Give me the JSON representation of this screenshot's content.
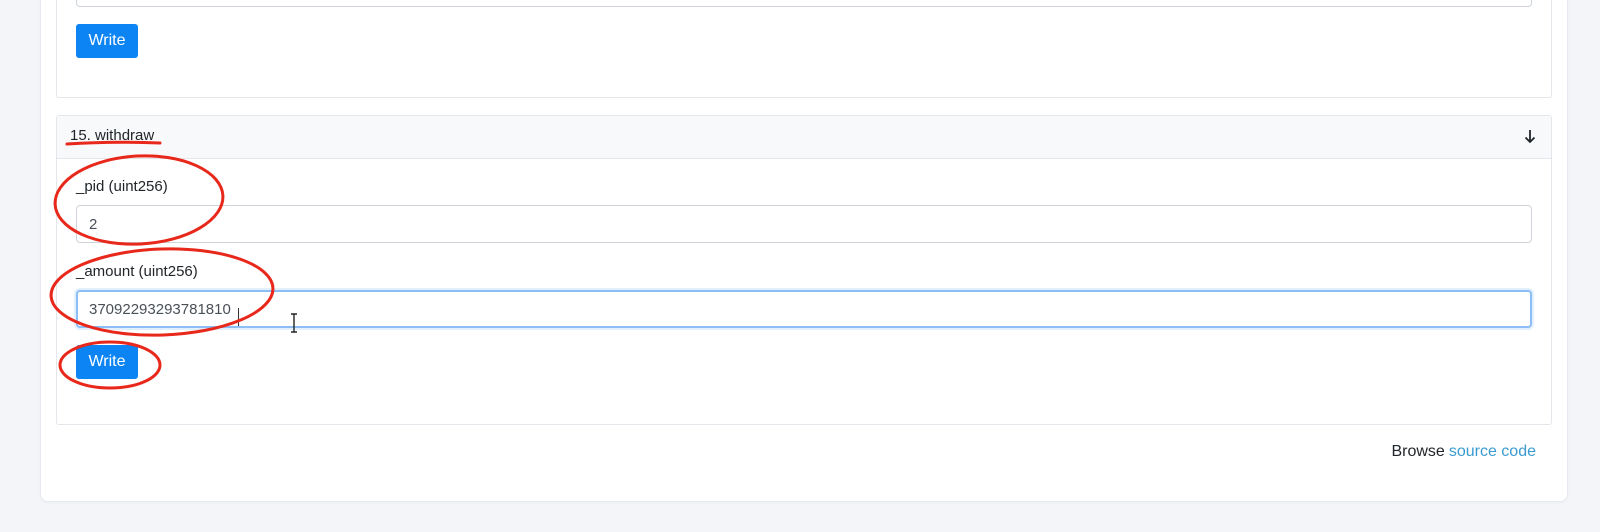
{
  "previous_function": {
    "write_label": "Write"
  },
  "function": {
    "title": "15. withdraw",
    "toggle_icon": "arrow-down-icon",
    "params": [
      {
        "label": "_pid (uint256)",
        "value": "2"
      },
      {
        "label": "_amount (uint256)",
        "value": "37092293293781810"
      }
    ],
    "write_label": "Write"
  },
  "footer": {
    "prefix": "Browse",
    "link_text": "source code"
  },
  "colors": {
    "primary_button": "#0d84f4",
    "annotation_red": "#e8281b",
    "link": "#3b9bd1"
  }
}
